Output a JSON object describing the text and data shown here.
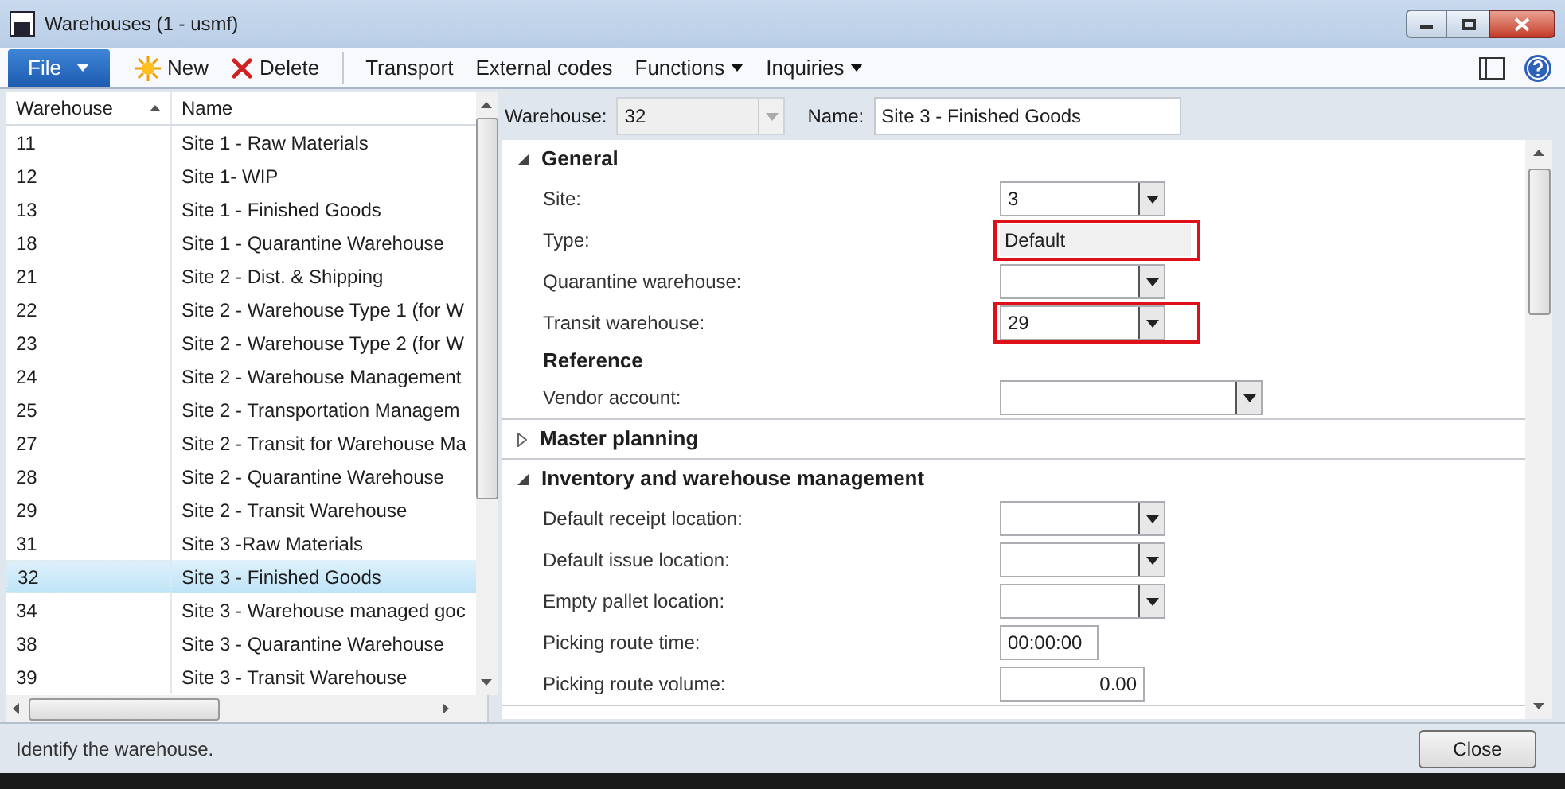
{
  "window": {
    "title": "Warehouses (1 - usmf)"
  },
  "toolbar": {
    "file_button": "File",
    "items": [
      {
        "label": "New",
        "kind": "new"
      },
      {
        "label": "Delete",
        "kind": "delete"
      },
      {
        "label": "Transport",
        "kind": "plain"
      },
      {
        "label": "External codes",
        "kind": "plain"
      },
      {
        "label": "Functions",
        "kind": "menu"
      },
      {
        "label": "Inquiries",
        "kind": "menu"
      }
    ]
  },
  "list": {
    "columns": [
      "Warehouse",
      "Name"
    ],
    "rows": [
      {
        "warehouse": "11",
        "name": "Site 1 - Raw Materials",
        "selected": false
      },
      {
        "warehouse": "12",
        "name": "Site 1- WIP",
        "selected": false
      },
      {
        "warehouse": "13",
        "name": "Site 1 - Finished Goods",
        "selected": false
      },
      {
        "warehouse": "18",
        "name": "Site 1 - Quarantine Warehouse",
        "selected": false
      },
      {
        "warehouse": "21",
        "name": "Site 2 - Dist. & Shipping",
        "selected": false
      },
      {
        "warehouse": "22",
        "name": "Site 2 - Warehouse Type 1 (for W",
        "selected": false
      },
      {
        "warehouse": "23",
        "name": "Site 2 - Warehouse Type 2 (for W",
        "selected": false
      },
      {
        "warehouse": "24",
        "name": "Site 2 - Warehouse Management",
        "selected": false
      },
      {
        "warehouse": "25",
        "name": "Site 2 - Transportation Managem",
        "selected": false
      },
      {
        "warehouse": "27",
        "name": "Site 2 - Transit for Warehouse Ma",
        "selected": false
      },
      {
        "warehouse": "28",
        "name": "Site 2 - Quarantine Warehouse",
        "selected": false
      },
      {
        "warehouse": "29",
        "name": "Site 2 - Transit Warehouse",
        "selected": false
      },
      {
        "warehouse": "31",
        "name": "Site 3 -Raw Materials",
        "selected": false
      },
      {
        "warehouse": "32",
        "name": "Site 3 - Finished Goods",
        "selected": true
      },
      {
        "warehouse": "34",
        "name": "Site 3 - Warehouse managed goc",
        "selected": false
      },
      {
        "warehouse": "38",
        "name": "Site 3 - Quarantine Warehouse",
        "selected": false
      },
      {
        "warehouse": "39",
        "name": "Site 3 - Transit Warehouse",
        "selected": false
      }
    ]
  },
  "header": {
    "warehouse_label": "Warehouse:",
    "warehouse_value": "32",
    "name_label": "Name:",
    "name_value": "Site 3 - Finished Goods"
  },
  "sections": [
    {
      "title": "General",
      "expanded": true,
      "rows": [
        {
          "kind": "combo",
          "label": "Site:",
          "value": "3",
          "highlighted": false
        },
        {
          "kind": "readonly",
          "label": "Type:",
          "value": "Default",
          "highlighted": true
        },
        {
          "kind": "combo",
          "label": "Quarantine warehouse:",
          "highlighted": false
        },
        {
          "kind": "combo",
          "label": "Transit warehouse:",
          "value": "29",
          "highlighted": true
        },
        {
          "kind": "heading",
          "label": "Reference"
        },
        {
          "kind": "wide_combo",
          "label": "Vendor account:",
          "highlighted": false
        }
      ]
    },
    {
      "title": "Master planning",
      "expanded": false
    },
    {
      "title": "Inventory and warehouse management",
      "expanded": true,
      "rows": [
        {
          "kind": "combo",
          "label": "Default receipt location:",
          "highlighted": false
        },
        {
          "kind": "combo",
          "label": "Default issue location:",
          "highlighted": false
        },
        {
          "kind": "combo",
          "label": "Empty pallet location:",
          "highlighted": false
        },
        {
          "kind": "time",
          "label": "Picking route time:",
          "value": "00:00:00",
          "highlighted": false
        },
        {
          "kind": "number",
          "label": "Picking route volume:",
          "value": "0.00",
          "highlighted": false
        }
      ]
    }
  ],
  "status_bar": {
    "text": "Identify the warehouse.",
    "close_button": "Close"
  }
}
